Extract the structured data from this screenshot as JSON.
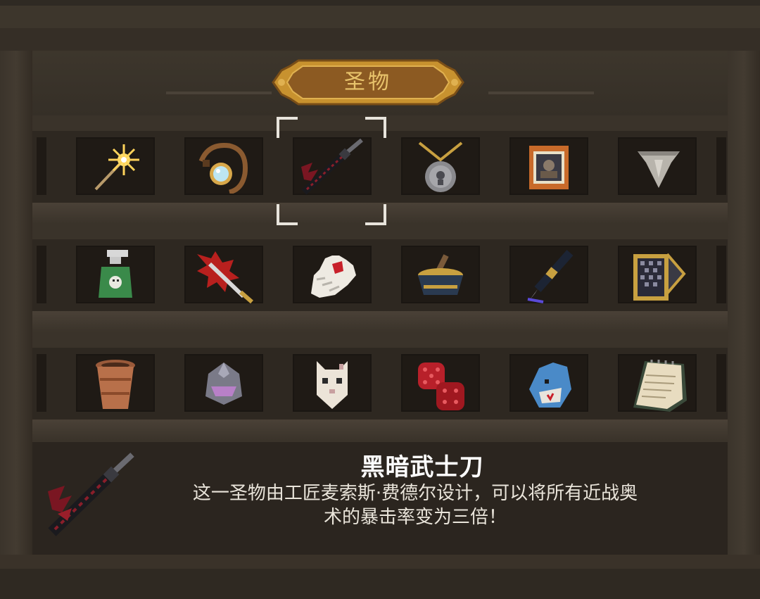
{
  "panel": {
    "title": "圣物"
  },
  "shelves": [
    {
      "items": [
        {
          "name": "sparkle-wand-icon",
          "icon": "sparkler-wand"
        },
        {
          "name": "magnifier-amulet-icon",
          "icon": "crystal-rope-amulet"
        },
        {
          "name": "dark-katana-icon",
          "icon": "dark-katana",
          "selected": true
        },
        {
          "name": "silver-pendant-icon",
          "icon": "silver-medallion"
        },
        {
          "name": "picture-frame-icon",
          "icon": "framed-portrait"
        },
        {
          "name": "shark-tooth-icon",
          "icon": "shark-tooth"
        }
      ]
    },
    {
      "items": [
        {
          "name": "skull-spray-bottle-icon",
          "icon": "poison-spray-bottle"
        },
        {
          "name": "spiked-blade-icon",
          "icon": "serrated-blade"
        },
        {
          "name": "white-glove-icon",
          "icon": "white-glove"
        },
        {
          "name": "mortar-bowl-icon",
          "icon": "mortar-and-pestle"
        },
        {
          "name": "fountain-pen-icon",
          "icon": "fountain-pen"
        },
        {
          "name": "card-deck-icon",
          "icon": "tarot-card-box"
        }
      ]
    },
    {
      "items": [
        {
          "name": "clay-pot-icon",
          "icon": "clay-pot"
        },
        {
          "name": "knight-helmet-icon",
          "icon": "steel-helmet"
        },
        {
          "name": "white-mask-icon",
          "icon": "cat-mask"
        },
        {
          "name": "red-dice-icon",
          "icon": "red-dice"
        },
        {
          "name": "shark-plush-icon",
          "icon": "shark-plush"
        },
        {
          "name": "notepad-icon",
          "icon": "spiral-notepad"
        }
      ]
    }
  ],
  "detail": {
    "title": "黑暗武士刀",
    "description_line1": "这一圣物由工匠麦索斯·费德尔设计，可以将所有近战奥",
    "description_line2": "术的暴击率变为三倍！",
    "icon": "dark-katana"
  },
  "colors": {
    "title_gold": "#e8c36b",
    "wood_dark": "#2a241e",
    "slot_bg": "#1f1a15",
    "selection": "#e8e4dc",
    "text_white": "#ffffff"
  }
}
